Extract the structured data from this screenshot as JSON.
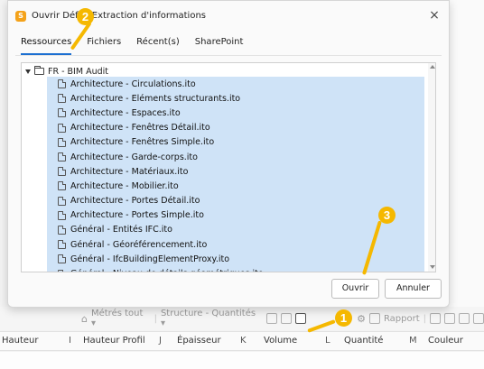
{
  "dialog": {
    "title": "Ouvrir Défini    Extraction d'informations",
    "tabs": [
      "Ressources",
      "Fichiers",
      "Récent(s)",
      "SharePoint"
    ],
    "root_label": "FR - BIM Audit",
    "files": [
      "Architecture - Circulations.ito",
      "Architecture - Eléments structurants.ito",
      "Architecture - Espaces.ito",
      "Architecture - Fenêtres Détail.ito",
      "Architecture - Fenêtres Simple.ito",
      "Architecture - Garde-corps.ito",
      "Architecture - Matériaux.ito",
      "Architecture - Mobilier.ito",
      "Architecture - Portes Détail.ito",
      "Architecture - Portes Simple.ito",
      "Général - Entités IFC.ito",
      "Général - Géoréférencement.ito",
      "Général - IfcBuildingElementProxy.ito",
      "Général - Niveau de détails géométriques.ito"
    ],
    "open_label": "Ouvrir",
    "cancel_label": "Annuler",
    "close_label": "×"
  },
  "toolbar": {
    "metrics_label": "Métrés tout ▾",
    "structure_label": "Structure - Quantités ▾",
    "report_label": "Rapport"
  },
  "columns": [
    {
      "letter": "",
      "label": "Hauteur"
    },
    {
      "letter": "I",
      "label": "Hauteur Profil"
    },
    {
      "letter": "J",
      "label": "Épaisseur"
    },
    {
      "letter": "K",
      "label": "Volume"
    },
    {
      "letter": "L",
      "label": "Quantité"
    },
    {
      "letter": "M",
      "label": "Couleur"
    }
  ],
  "callouts": [
    "1",
    "2",
    "3"
  ],
  "colors": {
    "callout": "#f5b800",
    "selection": "#cfe3f7",
    "accent": "#1c6fd1"
  }
}
